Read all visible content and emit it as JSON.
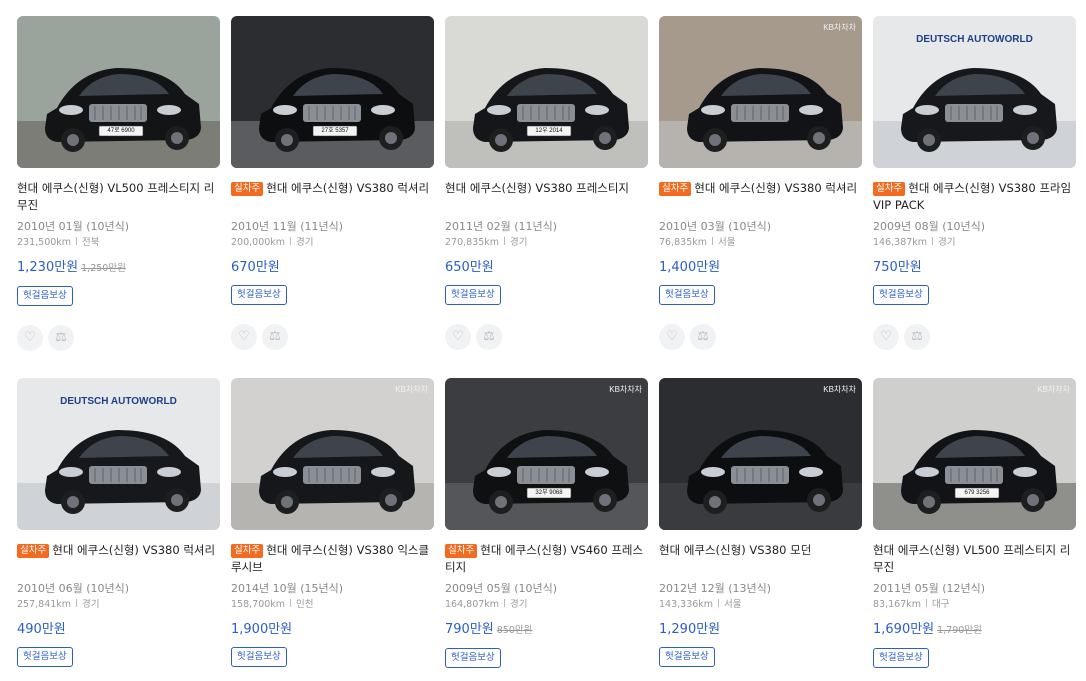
{
  "labels": {
    "real_driver": "실차주"
  },
  "cars": [
    {
      "title": "현대 에쿠스(신형) VL500 프레스티지 리무진",
      "badge": false,
      "year": "2010년 01월 (10년식)",
      "km": "231,500km",
      "region": "전북",
      "price": "1,230만원",
      "old_price": "1,250만원",
      "tag": "헛걸음보상",
      "photo": {
        "bg": "#9aa39c",
        "ground": "#7d7d77",
        "car": "#121416",
        "plate": "47로 6900",
        "logo": ""
      }
    },
    {
      "title": "현대 에쿠스(신형) VS380 럭셔리",
      "badge": true,
      "year": "2010년 11월 (11년식)",
      "km": "200,000km",
      "region": "경기",
      "price": "670만원",
      "old_price": "",
      "tag": "헛걸음보상",
      "photo": {
        "bg": "#2b2d30",
        "ground": "#5a5c60",
        "car": "#0d0e10",
        "plate": "27호 5357",
        "logo": ""
      }
    },
    {
      "title": "현대 에쿠스(신형) VS380 프레스티지",
      "badge": false,
      "year": "2011년 02월 (11년식)",
      "km": "270,835km",
      "region": "경기",
      "price": "650만원",
      "old_price": "",
      "tag": "헛걸음보상",
      "photo": {
        "bg": "#d9d9d6",
        "ground": "#bfbfbb",
        "car": "#14161a",
        "plate": "12우 2014",
        "logo": ""
      }
    },
    {
      "title": "현대 에쿠스(신형) VS380 럭셔리",
      "badge": true,
      "year": "2010년 03월 (10년식)",
      "km": "76,835km",
      "region": "서울",
      "price": "1,400만원",
      "old_price": "",
      "tag": "헛걸음보상",
      "photo": {
        "bg": "#a59a8c",
        "ground": "#b6b3ae",
        "car": "#121316",
        "plate": "",
        "logo": "KB차차차"
      }
    },
    {
      "title": "현대 에쿠스(신형) VS380 프라임 VIP PACK",
      "badge": true,
      "year": "2009년 08월 (10년식)",
      "km": "146,387km",
      "region": "경기",
      "price": "750만원",
      "old_price": "",
      "tag": "헛걸음보상",
      "photo": {
        "bg": "#e6e8ea",
        "ground": "#cfd2d6",
        "car": "#16181c",
        "plate": "",
        "logo": "DEUTSCH AUTOWORLD"
      }
    },
    {
      "title": "현대 에쿠스(신형) VS380 럭셔리",
      "badge": true,
      "year": "2010년 06월 (10년식)",
      "km": "257,841km",
      "region": "경기",
      "price": "490만원",
      "old_price": "",
      "tag": "헛걸음보상",
      "photo": {
        "bg": "#e6e8ea",
        "ground": "#cfd2d6",
        "car": "#16181c",
        "plate": "",
        "logo": "DEUTSCH AUTOWORLD"
      }
    },
    {
      "title": "현대 에쿠스(신형) VS380 익스클루시브",
      "badge": true,
      "year": "2014년 10월 (15년식)",
      "km": "158,700km",
      "region": "인천",
      "price": "1,900만원",
      "old_price": "",
      "tag": "헛걸음보상",
      "photo": {
        "bg": "#d2d1cf",
        "ground": "#b5b4b1",
        "car": "#15171a",
        "plate": "",
        "logo": "KB차차차"
      }
    },
    {
      "title": "현대 에쿠스(신형) VS460 프레스티지",
      "badge": true,
      "year": "2009년 05월 (10년식)",
      "km": "164,807km",
      "region": "경기",
      "price": "790만원",
      "old_price": "850만원",
      "tag": "헛걸음보상",
      "photo": {
        "bg": "#3b3d40",
        "ground": "#55565a",
        "car": "#0f1012",
        "plate": "32부 9068",
        "logo": "KB차차차"
      }
    },
    {
      "title": "현대 에쿠스(신형) VS380 모던",
      "badge": false,
      "year": "2012년 12월 (13년식)",
      "km": "143,336km",
      "region": "서울",
      "price": "1,290만원",
      "old_price": "",
      "tag": "헛걸음보상",
      "photo": {
        "bg": "#2c2d30",
        "ground": "#3a3b3e",
        "car": "#0d0e10",
        "plate": "",
        "logo": "KB차차차"
      }
    },
    {
      "title": "현대 에쿠스(신형) VL500 프레스티지 리무진",
      "badge": false,
      "year": "2011년 05월 (12년식)",
      "km": "83,167km",
      "region": "대구",
      "price": "1,690만원",
      "old_price": "1,790만원",
      "tag": "헛걸음보상",
      "photo": {
        "bg": "#cfcfcd",
        "ground": "#8f8f8c",
        "car": "#121316",
        "plate": "679 3256",
        "logo": "KB차차차"
      }
    }
  ]
}
